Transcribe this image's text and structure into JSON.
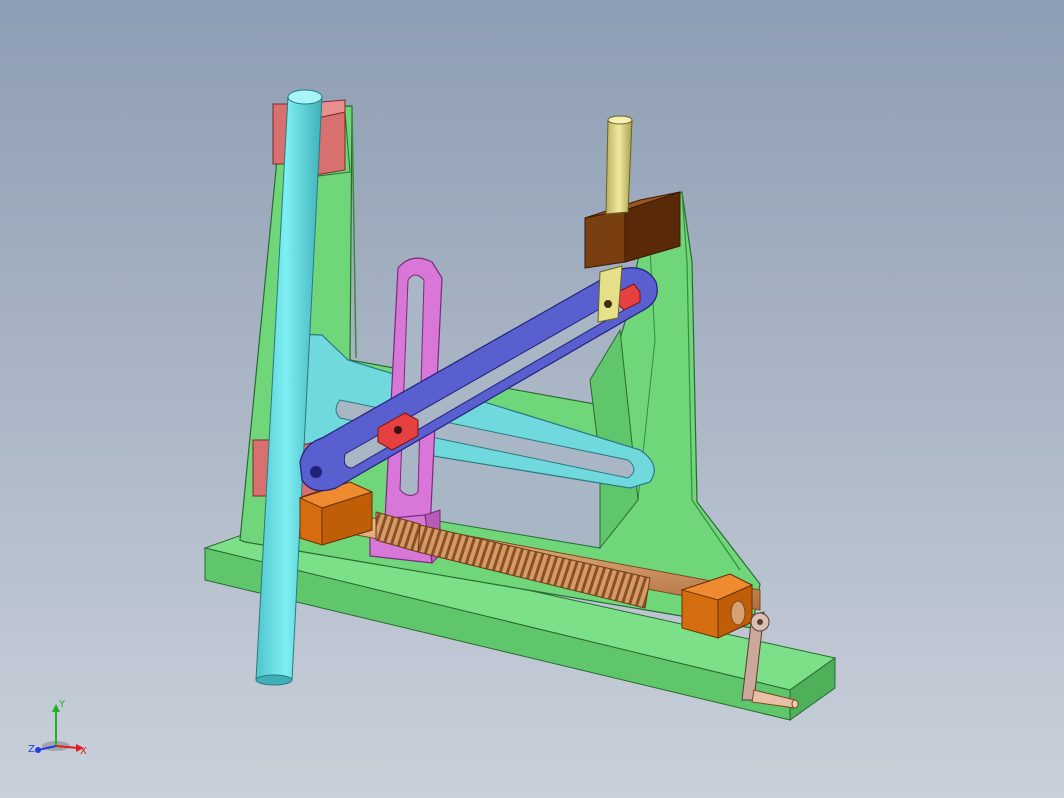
{
  "viewport": {
    "background_top": "#8d9db3",
    "background_bottom": "#c9d0da"
  },
  "parts": {
    "base_plate": "#69cf72",
    "frame": "#6fd67a",
    "column_rod": "#6fe0e6",
    "slotted_arm": "#6fd9dd",
    "vertical_slot_link": "#d877d8",
    "crank_link": "#5a5fd0",
    "slider_block": "#e64040",
    "top_guide_block": "#7a3f10",
    "top_pin": "#e6e08a",
    "guide_pads": "#d87070",
    "bearing_blocks": "#d56d10",
    "lead_screw": "#d8a070",
    "hand_crank": "#caa89a"
  },
  "triad": {
    "x_label": "X",
    "y_label": "Y",
    "z_label": "Z",
    "x_color": "#e02020",
    "y_color": "#20b020",
    "z_color": "#2040e0"
  }
}
